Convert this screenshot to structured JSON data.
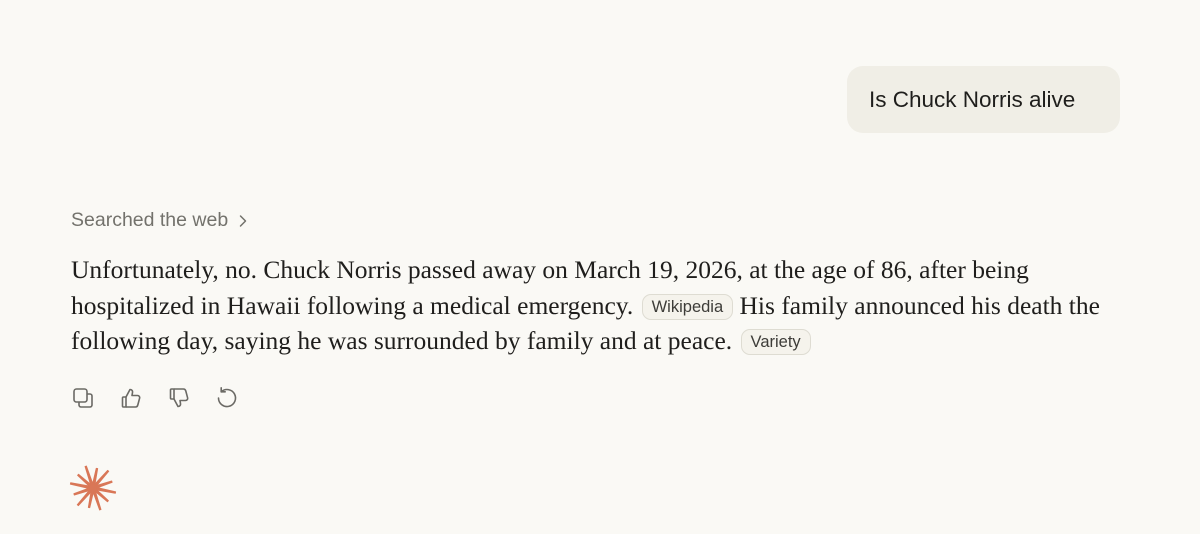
{
  "user_message": {
    "text": "Is Chuck Norris alive"
  },
  "assistant": {
    "searched_label": "Searched the web",
    "searched_chevron_icon": "chevron-right-icon",
    "paragraph": {
      "part1": "Unfortunately, no. Chuck Norris passed away on March 19, 2026, at the age of 86, after being hospitalized in Hawaii following a medical emergency. ",
      "citation1": "Wikipedia",
      "part2": " His family announced his death the following day, saying he was surrounded by family and at peace. ",
      "citation2": "Variety"
    },
    "actions": [
      {
        "icon": "copy-icon"
      },
      {
        "icon": "thumbs-up-icon"
      },
      {
        "icon": "thumbs-down-icon"
      },
      {
        "icon": "retry-icon"
      }
    ]
  },
  "logo": {
    "icon": "claude-spark-icon",
    "color": "#d97757"
  },
  "colors": {
    "background": "#faf9f5",
    "user_bubble": "#f0eee6",
    "text": "#1f1e1c",
    "muted_text": "#73726c",
    "icon_gray": "#6b6a65",
    "accent": "#d97757"
  }
}
